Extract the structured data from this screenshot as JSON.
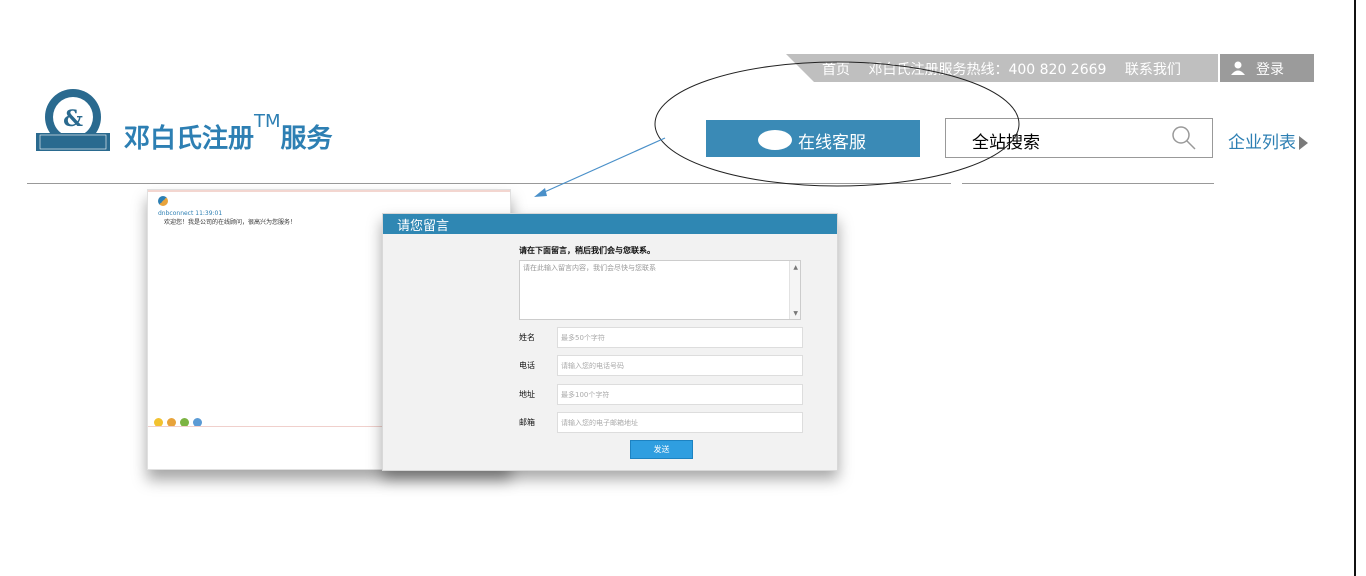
{
  "topbar": {
    "home": "首页",
    "hotline": "邓白氏注册服务热线：400 820 2669",
    "contact": "联系我们",
    "login": "登录"
  },
  "logo": {
    "title": "邓白氏注册",
    "tm": "TM",
    "title_suffix": "服务"
  },
  "header": {
    "online_service": "在线客服",
    "search": "全站搜索",
    "company_list": "企业列表"
  },
  "chat_window": {
    "sender": "dnbconnect 11:39:01",
    "message": "欢迎您！我是公司的在线顾问，很高兴为您服务！"
  },
  "message_dialog": {
    "title": "请您留言",
    "intro": "请在下面留言，稍后我们会与您联系。",
    "content_placeholder": "请在此输入留言内容，我们会尽快与您联系",
    "fields": [
      {
        "label": "姓名",
        "placeholder": "最多50个字符"
      },
      {
        "label": "电话",
        "placeholder": "请输入您的电话号码"
      },
      {
        "label": "地址",
        "placeholder": "最多100个字符"
      },
      {
        "label": "邮箱",
        "placeholder": "请输入您的电子邮箱地址"
      }
    ],
    "send": "发送"
  },
  "colors": {
    "brand_blue": "#2d7fb3",
    "button_blue": "#3a8ab6",
    "topbar_gray": "#bfbfbf"
  }
}
